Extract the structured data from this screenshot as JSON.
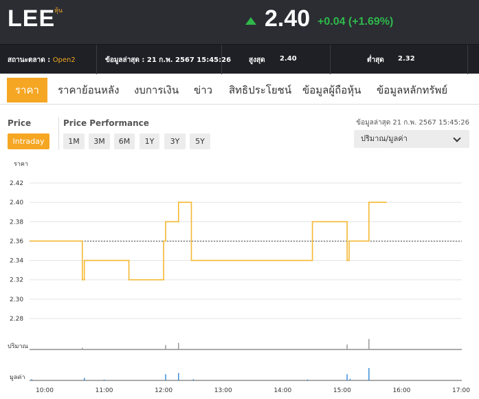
{
  "quote": {
    "symbol": "LEE",
    "symbol_tag": "หุ้น",
    "price": "2.40",
    "change": "+0.04 (+1.69%)",
    "direction": "up",
    "up_color": "#2fb84a"
  },
  "infobar": {
    "market_status_label": "สถานะตลาด :",
    "market_status_value": "Open2",
    "last_update": "ข้อมูลล่าสุด : 21 ก.พ. 2567 15:45:26",
    "high_label": "สูงสุด",
    "high_value": "2.40",
    "low_label": "ต่ำสุด",
    "low_value": "2.32"
  },
  "tabs": [
    {
      "label": "ราคา",
      "active": true
    },
    {
      "label": "ราคาย้อนหลัง"
    },
    {
      "label": "งบการเงิน"
    },
    {
      "label": "ข่าว"
    },
    {
      "label": "สิทธิประโยชน์"
    },
    {
      "label": "ข้อมูลผู้ถือหุ้น"
    },
    {
      "label": "ข้อมูลหลักทรัพย์"
    }
  ],
  "controls": {
    "price_label": "Price",
    "intraday_label": "Intraday",
    "performance_label": "Price Performance",
    "periods": [
      "1M",
      "3M",
      "6M",
      "1Y",
      "3Y",
      "5Y"
    ],
    "updated_text": "ข้อมูลล่าสุด 21 ก.พ. 2567 15:45:26",
    "select_value": "ปริมาณ/มูลค่า",
    "accent": "#f5a623"
  },
  "chart_data": {
    "type": "line",
    "ylabel": "ราคา",
    "yticks": [
      "2.42",
      "2.40",
      "2.38",
      "2.36",
      "2.34",
      "2.32",
      "2.30",
      "2.28"
    ],
    "ylim": [
      2.28,
      2.42
    ],
    "xticks": [
      "10:00",
      "11:00",
      "12:00",
      "13:00",
      "14:00",
      "15:00",
      "16:00",
      "17:00"
    ],
    "reference_price": 2.36,
    "line_color": "#f5b731",
    "series": [
      {
        "x": [
          "09:45",
          "10:38",
          "10:38",
          "10:40",
          "10:40",
          "10:42",
          "10:42",
          "11:25",
          "11:25",
          "12:00",
          "12:00",
          "12:02",
          "12:02",
          "12:15",
          "12:15",
          "12:28",
          "12:28",
          "14:30",
          "14:30",
          "15:05",
          "15:05",
          "15:07",
          "15:07",
          "15:08",
          "15:08",
          "15:27",
          "15:27",
          "15:45"
        ],
        "y": [
          2.36,
          2.36,
          2.32,
          2.32,
          2.34,
          2.34,
          2.34,
          2.34,
          2.32,
          2.32,
          2.36,
          2.36,
          2.38,
          2.38,
          2.4,
          2.4,
          2.34,
          2.34,
          2.38,
          2.38,
          2.34,
          2.34,
          2.36,
          2.36,
          2.36,
          2.36,
          2.4,
          2.4
        ]
      }
    ],
    "volume_label": "ปริมาณ",
    "volume_color": "#999999",
    "volume_bars": [
      {
        "t": "10:38",
        "v": 0.6
      },
      {
        "t": "12:02",
        "v": 1.6
      },
      {
        "t": "12:15",
        "v": 2.4
      },
      {
        "t": "15:05",
        "v": 1.8
      },
      {
        "t": "15:27",
        "v": 3.8
      }
    ],
    "value_label": "มูลค่า",
    "value_color": "#3b8ed8",
    "value_bars": [
      {
        "t": "09:47",
        "v": 0.4
      },
      {
        "t": "10:40",
        "v": 0.8
      },
      {
        "t": "11:00",
        "v": 0.3
      },
      {
        "t": "12:02",
        "v": 2.0
      },
      {
        "t": "12:15",
        "v": 2.4
      },
      {
        "t": "12:30",
        "v": 0.4
      },
      {
        "t": "14:25",
        "v": 0.3
      },
      {
        "t": "15:05",
        "v": 2.0
      },
      {
        "t": "15:08",
        "v": 0.5
      },
      {
        "t": "15:27",
        "v": 4.0
      }
    ]
  }
}
